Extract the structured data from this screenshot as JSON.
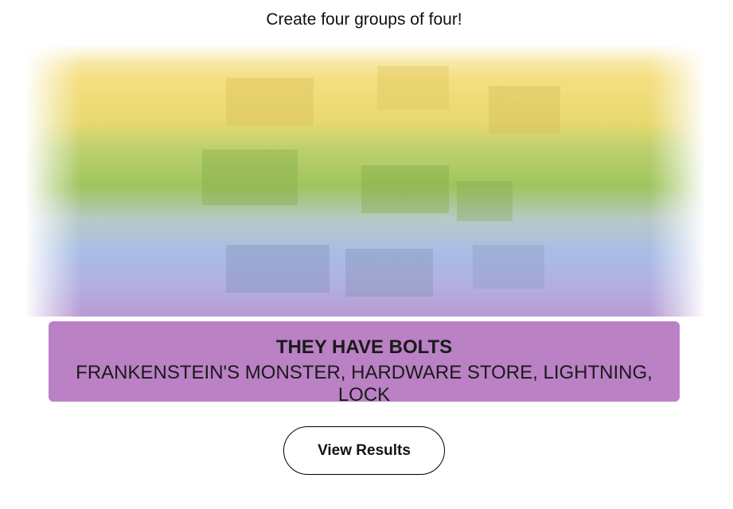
{
  "instruction": "Create four groups of four!",
  "board": {
    "state": "blurred",
    "band_colors": [
      "#f3dc7a",
      "#a7c86a",
      "#b1c4ec",
      "#bb81c5"
    ]
  },
  "solved_group": {
    "title": "THEY HAVE BOLTS",
    "members": "FRANKENSTEIN'S MONSTER, HARDWARE STORE, LIGHTNING, LOCK",
    "color": "#ba81c5"
  },
  "actions": {
    "view_results_label": "View Results"
  }
}
